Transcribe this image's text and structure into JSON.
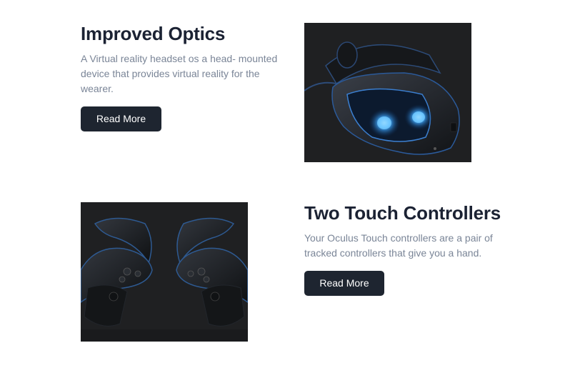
{
  "features": [
    {
      "title": "Improved Optics",
      "description": "A Virtual reality headset os a head- mounted device that provides virtual reality for the wearer.",
      "button_label": "Read More",
      "image": "vr-headset-image"
    },
    {
      "title": "Two Touch Controllers",
      "description": "Your Oculus Touch controllers are a pair of tracked controllers that give you a hand.",
      "button_label": "Read More",
      "image": "touch-controllers-image"
    }
  ],
  "colors": {
    "title": "#1b2233",
    "description": "#7a8597",
    "button_bg": "#1e2530",
    "button_text": "#ffffff",
    "photo_bg": "#1f2022",
    "lens_glow": "#3fa9ff"
  }
}
